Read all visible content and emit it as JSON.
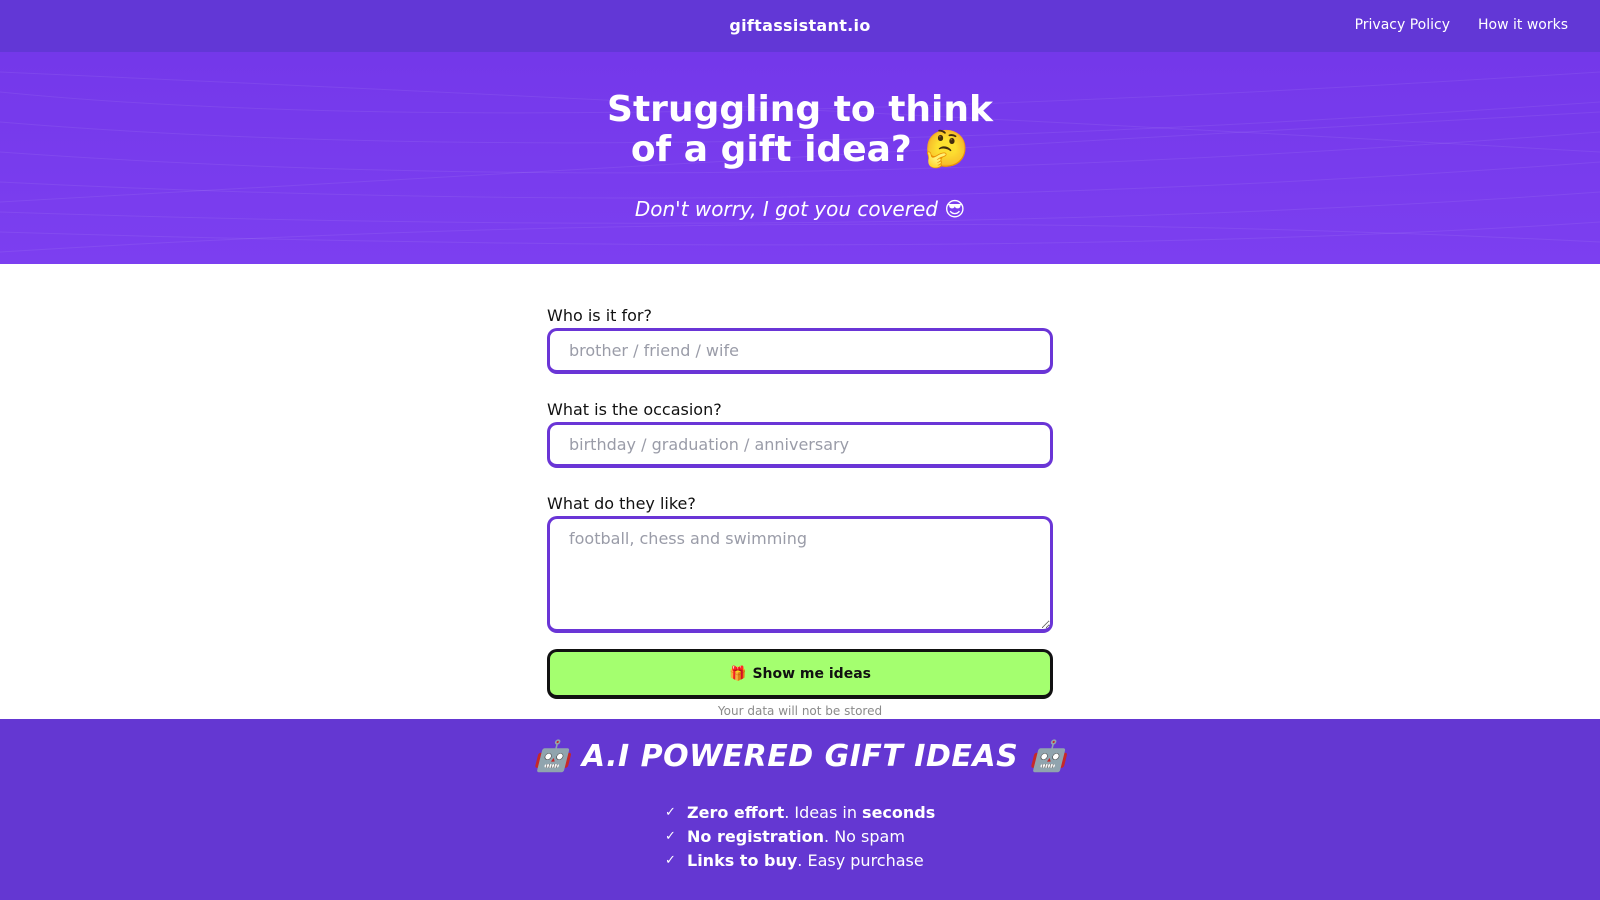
{
  "header": {
    "brand": "giftassistant.io",
    "nav": [
      "Privacy Policy",
      "How it works"
    ]
  },
  "hero": {
    "title_line1": "Struggling to think",
    "title_line2": "of a gift idea? 🤔",
    "subtitle": "Don't worry, I got you covered 😎"
  },
  "form": {
    "who_label": "Who is it for?",
    "who_placeholder": "brother / friend / wife",
    "occasion_label": "What is the occasion?",
    "occasion_placeholder": "birthday / graduation / anniversary",
    "likes_label": "What do they like?",
    "likes_placeholder": "football, chess and swimming",
    "submit_icon": "🎁",
    "submit_label": "Show me ideas",
    "privacy_note": "Your data will not be stored"
  },
  "features": {
    "title": "🤖 A.I POWERED GIFT IDEAS 🤖",
    "items": [
      {
        "bold": "Zero effort",
        "rest": ". Ideas in ",
        "bold2": "seconds"
      },
      {
        "bold": "No registration",
        "rest": ". No spam",
        "bold2": ""
      },
      {
        "bold": "Links to buy",
        "rest": ". Easy purchase",
        "bold2": ""
      }
    ],
    "check_icon": "check-icon"
  },
  "colors": {
    "header_bg": "#6237d6",
    "hero_bg": "#7438ea",
    "input_border": "#6a35d6",
    "button_bg": "#a4ff6f",
    "features_bg": "#6437d2"
  }
}
